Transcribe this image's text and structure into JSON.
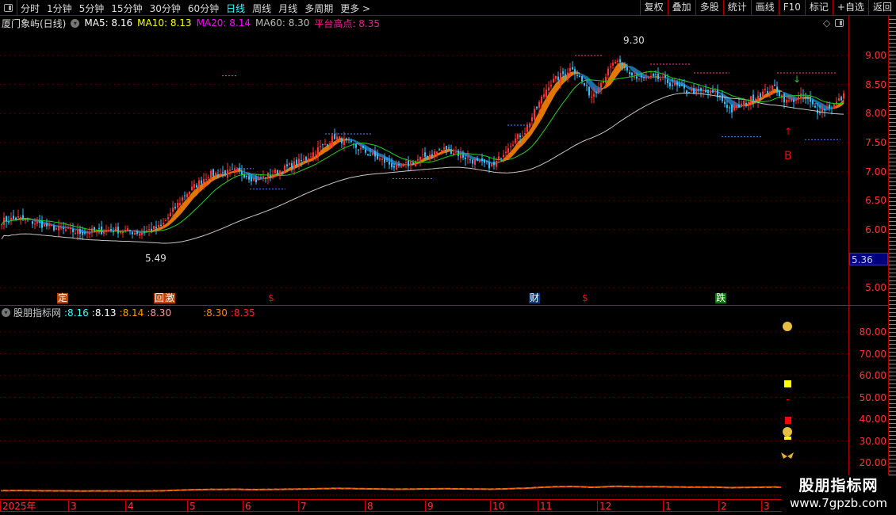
{
  "toolbar": {
    "periods": [
      "分时",
      "1分钟",
      "5分钟",
      "15分钟",
      "30分钟",
      "60分钟",
      "日线",
      "周线",
      "月线",
      "多周期",
      "更多 >"
    ],
    "active_period": "日线",
    "buttons": [
      "复权",
      "叠加",
      "多股",
      "统计",
      "画线",
      "F10",
      "标记",
      "+自选",
      "返回"
    ]
  },
  "legend": {
    "title": "厦门象屿(日线)",
    "ma5": "MA5: 8.16",
    "ma10": "MA10: 8.13",
    "ma20": "MA20: 8.14",
    "ma60": "MA60: 8.30",
    "platform": "平台高点: 8.35"
  },
  "main": {
    "high_label": "9.30",
    "low_label": "5.49",
    "current_price": "5.36",
    "buy_signal": "B",
    "price_ticks": [
      "9.00",
      "8.50",
      "8.00",
      "7.50",
      "7.00",
      "6.50",
      "6.00",
      "5.00"
    ],
    "markers": [
      {
        "text": "定",
        "color": "#c04000"
      },
      {
        "text": "回",
        "color": "#c04000"
      },
      {
        "text": "激",
        "color": "#c04000"
      },
      {
        "text": "$",
        "color": "#f00"
      },
      {
        "text": "财",
        "color": "#0a3a7a"
      },
      {
        "text": "$",
        "color": "#f00"
      },
      {
        "text": "跌",
        "color": "#007a00"
      }
    ]
  },
  "indicator": {
    "name": "股朋指标网",
    "values": [
      ":8.16",
      ":8.13",
      ":8.14",
      ":8.30",
      ":8.30",
      ":8.35"
    ],
    "ticks": [
      "80.00",
      "70.00",
      "60.00",
      "50.00",
      "40.00",
      "30.00",
      "20.00"
    ]
  },
  "xaxis": {
    "labels": [
      "2025年",
      "3",
      "4",
      "5",
      "6",
      "7",
      "8",
      "9",
      "10",
      "11",
      "12",
      "1",
      "2",
      "3"
    ]
  },
  "watermark": {
    "name": "股朋指标网",
    "url": "www.7gpzb.com"
  },
  "colors": {
    "up": "#ff3030",
    "down": "#30c0ff",
    "ma60": "#c8c8c8",
    "ma20": "#20d020",
    "ribbon_up": "#e07800",
    "ribbon_down": "#1a6ea8",
    "axis": "#ff3333"
  },
  "chart_data": {
    "type": "candlestick",
    "ylim": [
      4.8,
      9.6
    ],
    "keypoints_bar_price": [
      [
        0,
        6.15
      ],
      [
        7,
        6.2
      ],
      [
        20,
        6.05
      ],
      [
        33,
        5.95
      ],
      [
        47,
        6.0
      ],
      [
        58,
        5.95
      ],
      [
        67,
        6.05
      ],
      [
        77,
        6.6
      ],
      [
        87,
        6.95
      ],
      [
        100,
        7.0
      ],
      [
        107,
        6.85
      ],
      [
        113,
        6.95
      ],
      [
        127,
        7.2
      ],
      [
        140,
        7.6
      ],
      [
        150,
        7.4
      ],
      [
        167,
        7.05
      ],
      [
        180,
        7.3
      ],
      [
        187,
        7.4
      ],
      [
        200,
        7.15
      ],
      [
        207,
        7.1
      ],
      [
        213,
        7.45
      ],
      [
        220,
        7.7
      ],
      [
        230,
        8.5
      ],
      [
        240,
        8.8
      ],
      [
        248,
        8.3
      ],
      [
        258,
        8.9
      ],
      [
        267,
        8.6
      ],
      [
        277,
        8.6
      ],
      [
        287,
        8.4
      ],
      [
        300,
        8.35
      ],
      [
        307,
        8.05
      ],
      [
        317,
        8.3
      ],
      [
        325,
        8.45
      ],
      [
        330,
        8.2
      ],
      [
        337,
        8.3
      ],
      [
        343,
        8.05
      ],
      [
        350,
        8.15
      ],
      [
        354,
        8.3
      ]
    ]
  }
}
